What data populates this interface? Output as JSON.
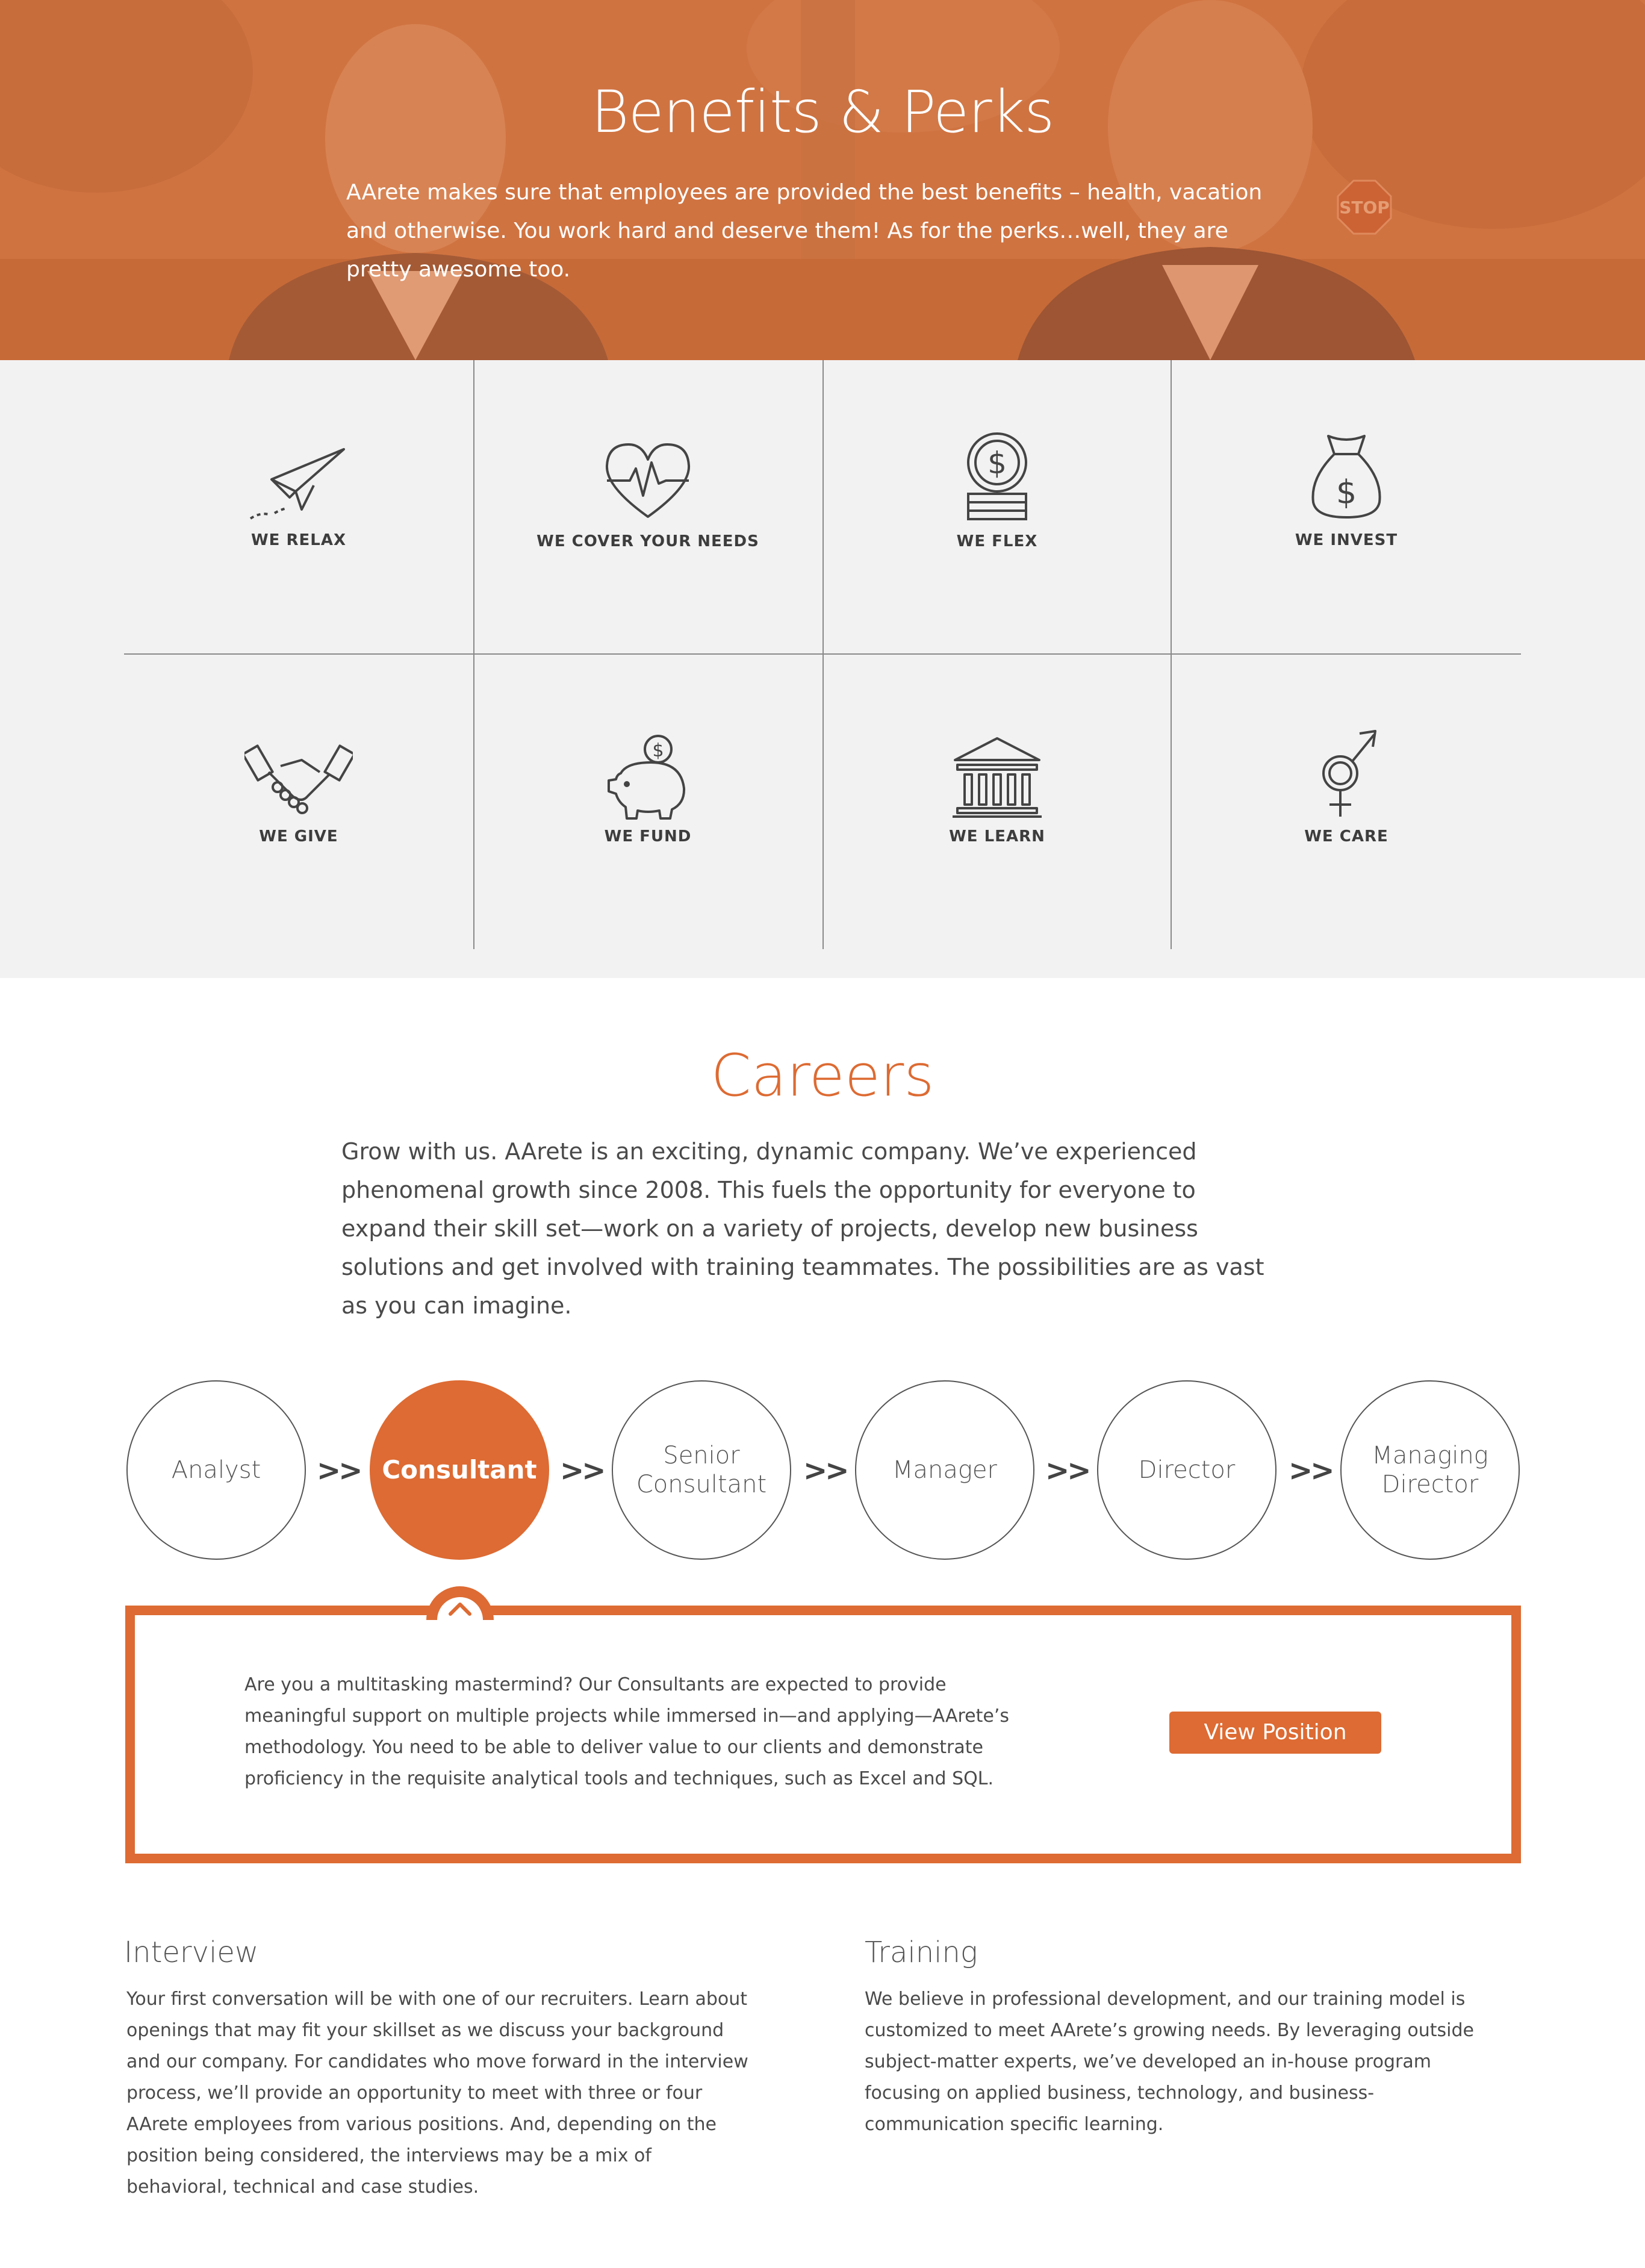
{
  "hero": {
    "title": "Benefits & Perks",
    "text": "AArete makes sure that employees are provided the best benefits – health, vacation and otherwise. You work hard and deserve them! As for the perks…well, they are pretty awesome too.",
    "stop_sign": "STOP"
  },
  "benefits": [
    {
      "label": "WE RELAX",
      "icon": "paper-plane-icon"
    },
    {
      "label": "WE COVER YOUR NEEDS",
      "icon": "heart-pulse-icon"
    },
    {
      "label": "WE FLEX",
      "icon": "coin-stack-icon"
    },
    {
      "label": "WE INVEST",
      "icon": "money-bag-icon"
    },
    {
      "label": "WE GIVE",
      "icon": "handshake-icon"
    },
    {
      "label": "WE FUND",
      "icon": "piggy-bank-icon"
    },
    {
      "label": "WE LEARN",
      "icon": "bank-building-icon"
    },
    {
      "label": "WE CARE",
      "icon": "gender-icon"
    }
  ],
  "careers": {
    "title": "Careers",
    "text": "Grow with us. AArete is an exciting, dynamic company. We’ve experienced phenomenal growth since 2008. This fuels the opportunity for everyone to expand their skill set—work on a variety of projects, develop new business solutions and get involved with training teammates. The possibilities are as vast as you can imagine."
  },
  "path": {
    "steps": [
      {
        "line1": "Analyst",
        "line2": ""
      },
      {
        "line1": "Consultant",
        "line2": ""
      },
      {
        "line1": "Senior",
        "line2": "Consultant"
      },
      {
        "line1": "Manager",
        "line2": ""
      },
      {
        "line1": "Director",
        "line2": ""
      },
      {
        "line1": "Managing",
        "line2": "Director"
      }
    ],
    "separator": ">>",
    "active": "Consultant"
  },
  "detail": {
    "text": "Are you a multitasking mastermind? Our Consultants are expected to provide meaningful support on multiple projects while immersed in—and applying—AArete’s methodology. You need to be able to deliver value to our clients and demonstrate proficiency in the requisite analytical tools and techniques, such as Excel and SQL.",
    "button": "View Position"
  },
  "interview": {
    "title": "Interview",
    "text": "Your first conversation will be with one of our recruiters. Learn about openings that may fit your skillset as we discuss your background and our company. For candidates who move forward in the interview process, we’ll provide an opportunity to meet with three or four AArete employees from various positions. And, depending on the position being considered, the interviews may be a mix of behavioral, technical and case studies."
  },
  "training": {
    "title": "Training",
    "text": "We believe in professional development, and our training model is customized to meet AArete’s growing needs. By leveraging outside subject-matter experts, we’ve developed an in-house program focusing on applied business, technology, and business-communication specific learning."
  },
  "colors": {
    "accent": "#dd6b33",
    "grid_bg": "#f2f2f2",
    "text": "#4a4a4a"
  }
}
